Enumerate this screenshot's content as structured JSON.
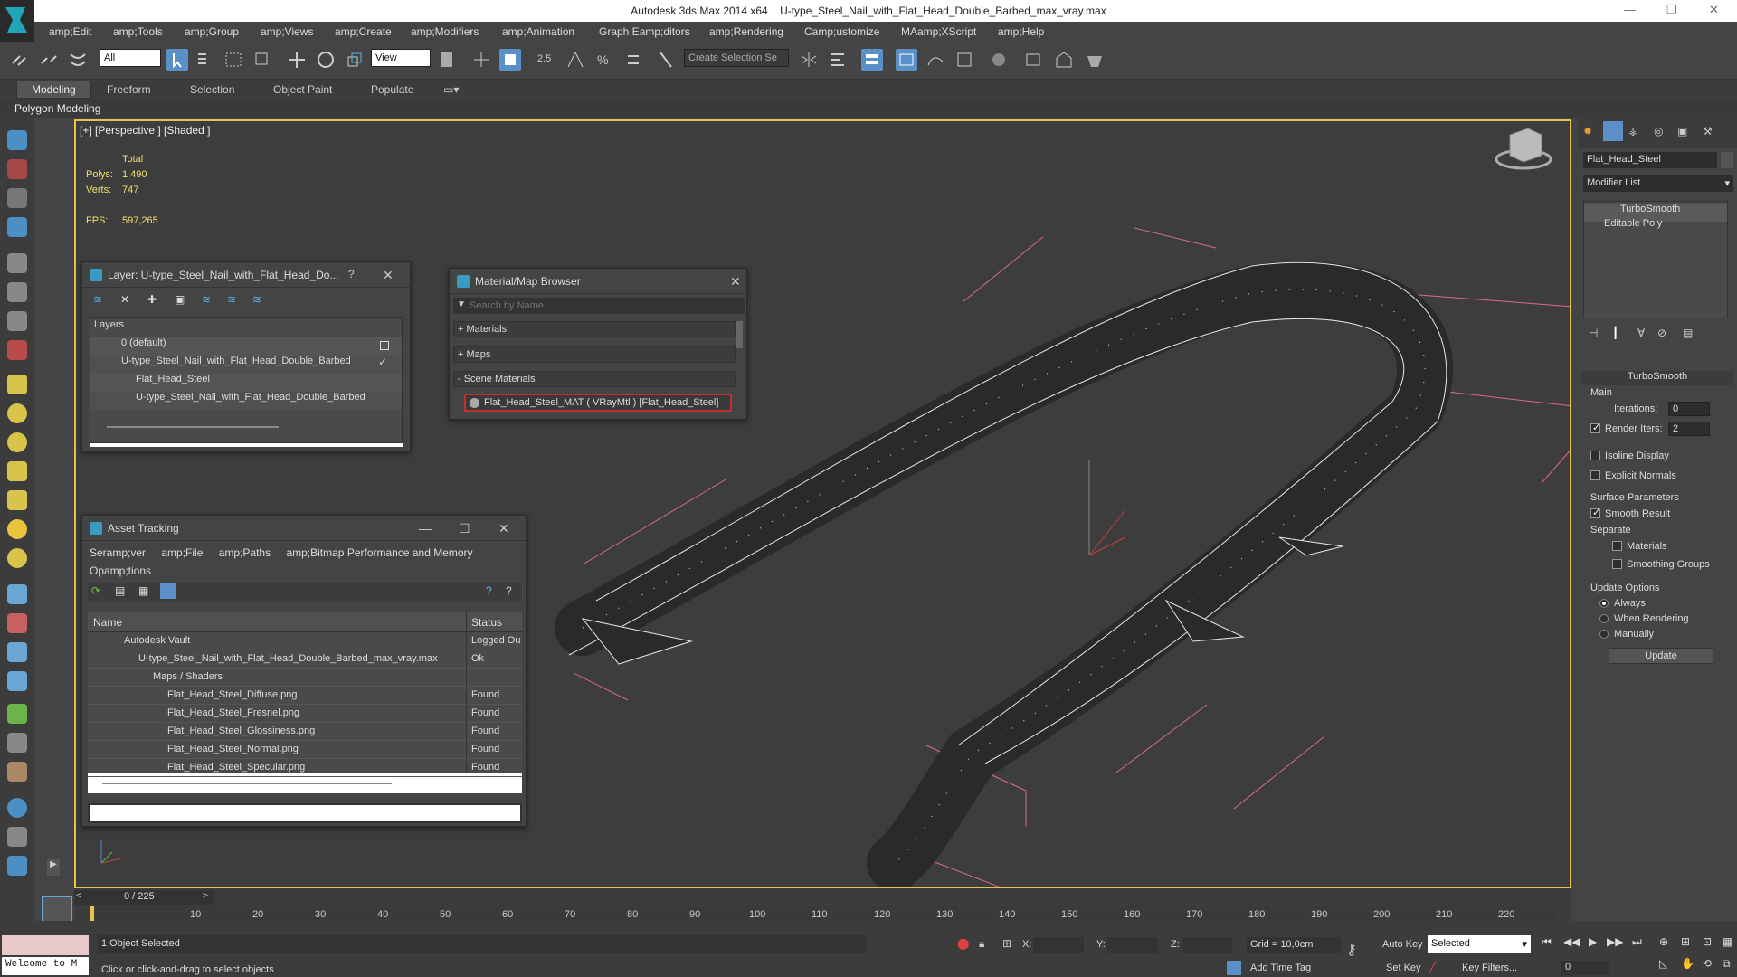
{
  "window": {
    "app": "Autodesk 3ds Max  2014 x64",
    "file": "U-type_Steel_Nail_with_Flat_Head_Double_Barbed_max_vray.max"
  },
  "menu": [
    "amp;Edit",
    "amp;Tools",
    "amp;Group",
    "amp;Views",
    "amp;Create",
    "amp;Modifiers",
    "amp;Animation",
    "Graph Eamp;ditors",
    "amp;Rendering",
    "Camp;ustomize",
    "MAamp;XScript",
    "amp;Help"
  ],
  "toolbar": {
    "filter": "All",
    "refcoord": "View",
    "selection_set": "Create Selection Se"
  },
  "ribbon": {
    "tabs": [
      "Modeling",
      "Freeform",
      "Selection",
      "Object Paint",
      "Populate"
    ],
    "sub": "Polygon Modeling"
  },
  "viewport": {
    "label": "[+] [Perspective ] [Shaded ]",
    "stats_total": "Total",
    "polys_label": "Polys:",
    "polys": "1 490",
    "verts_label": "Verts:",
    "verts": "747",
    "fps_label": "FPS:",
    "fps": "597,265"
  },
  "layer_panel": {
    "title": "Layer: U-type_Steel_Nail_with_Flat_Head_Do...",
    "help": "?",
    "header": "Layers",
    "rows": [
      "0 (default)",
      "U-type_Steel_Nail_with_Flat_Head_Double_Barbed",
      "Flat_Head_Steel",
      "U-type_Steel_Nail_with_Flat_Head_Double_Barbed"
    ]
  },
  "material_browser": {
    "title": "Material/Map Browser",
    "search_placeholder": "Search by Name ...",
    "sections": [
      "+ Materials",
      "+ Maps",
      "- Scene Materials"
    ],
    "selected": "Flat_Head_Steel_MAT  ( VRayMtl )  [Flat_Head_Steel]"
  },
  "asset_tracking": {
    "title": "Asset Tracking",
    "menu": [
      "Seramp;ver",
      "amp;File",
      "amp;Paths",
      "amp;Bitmap Performance and Memory"
    ],
    "menu2": "Opamp;tions",
    "col_name": "Name",
    "col_status": "Status",
    "rows": [
      {
        "name": "Autodesk Vault",
        "status": "Logged Ou"
      },
      {
        "name": "U-type_Steel_Nail_with_Flat_Head_Double_Barbed_max_vray.max",
        "status": "Ok"
      },
      {
        "name": "Maps / Shaders",
        "status": ""
      },
      {
        "name": "Flat_Head_Steel_Diffuse.png",
        "status": "Found"
      },
      {
        "name": "Flat_Head_Steel_Fresnel.png",
        "status": "Found"
      },
      {
        "name": "Flat_Head_Steel_Glossiness.png",
        "status": "Found"
      },
      {
        "name": "Flat_Head_Steel_Normal.png",
        "status": "Found"
      },
      {
        "name": "Flat_Head_Steel_Specular.png",
        "status": "Found"
      }
    ]
  },
  "command_panel": {
    "object_name": "Flat_Head_Steel",
    "modifier_list": "Modifier List",
    "stack": [
      "TurboSmooth",
      "Editable Poly"
    ],
    "rollout_title": "TurboSmooth",
    "main": "Main",
    "iterations_label": "Iterations:",
    "iterations": "0",
    "render_iters_label": "Render Iters:",
    "render_iters": "2",
    "isoline": "Isoline Display",
    "explicit": "Explicit Normals",
    "surface": "Surface Parameters",
    "smooth_result": "Smooth Result",
    "separate": "Separate",
    "materials": "Materials",
    "smoothing": "Smoothing Groups",
    "update_options": "Update Options",
    "always": "Always",
    "when_rendering": "When Rendering",
    "manually": "Manually",
    "update_btn": "Update"
  },
  "timeline": {
    "frame": "0 / 225",
    "ticks": [
      "10",
      "20",
      "30",
      "40",
      "50",
      "60",
      "70",
      "80",
      "90",
      "100",
      "110",
      "120",
      "130",
      "140",
      "150",
      "160",
      "170",
      "180",
      "190",
      "200",
      "210",
      "220"
    ]
  },
  "status": {
    "welcome": "Welcome to M",
    "selected": "1 Object Selected",
    "prompt": "Click or click-and-drag to select objects",
    "x": "X:",
    "y": "Y:",
    "z": "Z:",
    "grid": "Grid = 10,0cm",
    "add_time_tag": "Add Time Tag",
    "auto_key": "Auto Key",
    "set_key": "Set Key",
    "key_mode": "Selected",
    "key_filters": "Key Filters...",
    "frame_field": "0"
  }
}
